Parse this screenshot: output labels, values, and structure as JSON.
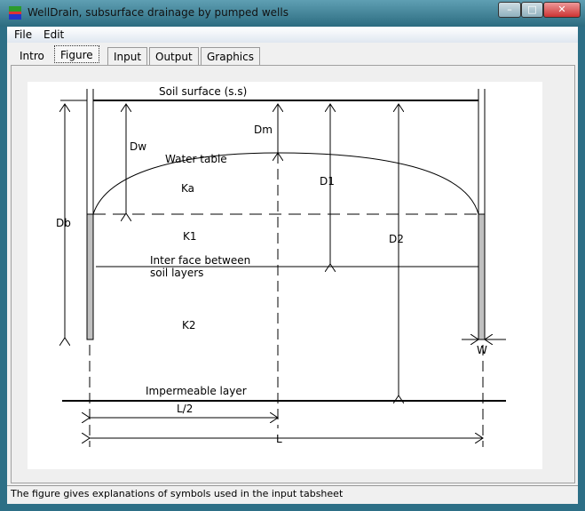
{
  "window": {
    "title": "WellDrain, subsurface drainage by pumped wells",
    "controls": [
      "minimize",
      "maximize",
      "close"
    ]
  },
  "menu": [
    "File",
    "Edit"
  ],
  "tabs": [
    {
      "label": "Intro"
    },
    {
      "label": "Figure",
      "active": true
    },
    {
      "label": "Input"
    },
    {
      "label": "Output"
    },
    {
      "label": "Graphics"
    }
  ],
  "figure": {
    "soil_surface": "Soil surface (s.s)",
    "water_table": "Water table",
    "interface_line1": "Inter face between",
    "interface_line2": "soil layers",
    "impermeable": "Impermeable layer",
    "Dw": "Dw",
    "Dm": "Dm",
    "D1": "D1",
    "D2": "D2",
    "Db": "Db",
    "Ka": "Ka",
    "K1": "K1",
    "K2": "K2",
    "W": "W",
    "L_half": "L/2",
    "L": "L"
  },
  "status": "The figure gives explanations of symbols used in the input tabsheet"
}
